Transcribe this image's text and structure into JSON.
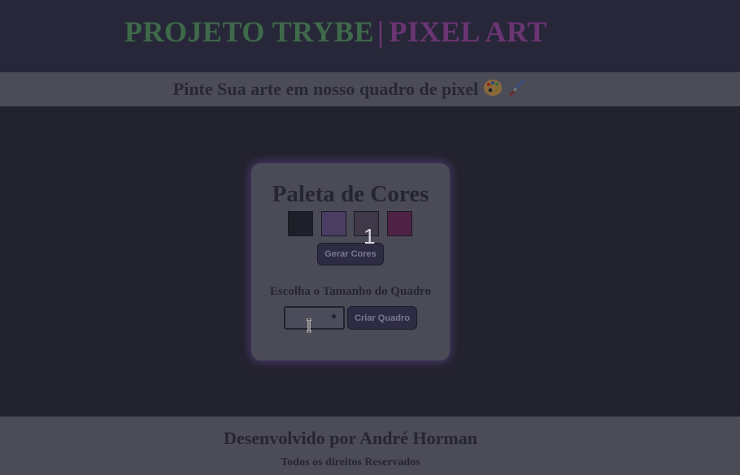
{
  "header": {
    "title_part1": "PROJETO TRYBE",
    "separator": "|",
    "title_part2": "PIXEL ART"
  },
  "subtitle": {
    "text": "Pinte Sua arte em nosso quadro de pixel",
    "emojis": [
      "palette-icon",
      "paintbrush-icon"
    ]
  },
  "palette": {
    "title": "Paleta de Cores",
    "colors": [
      "#1d2028",
      "#4a3d62",
      "#3f3848",
      "#4e2244"
    ],
    "generate_label": "Gerar Cores",
    "badge": "1"
  },
  "board_size": {
    "label": "Escolha o Tamanho do Quadro",
    "input_value": "",
    "create_label": "Criar Quadro"
  },
  "footer": {
    "title": "Desenvolvido por André Horman",
    "subtitle": "Todos os direitos Reservados"
  }
}
